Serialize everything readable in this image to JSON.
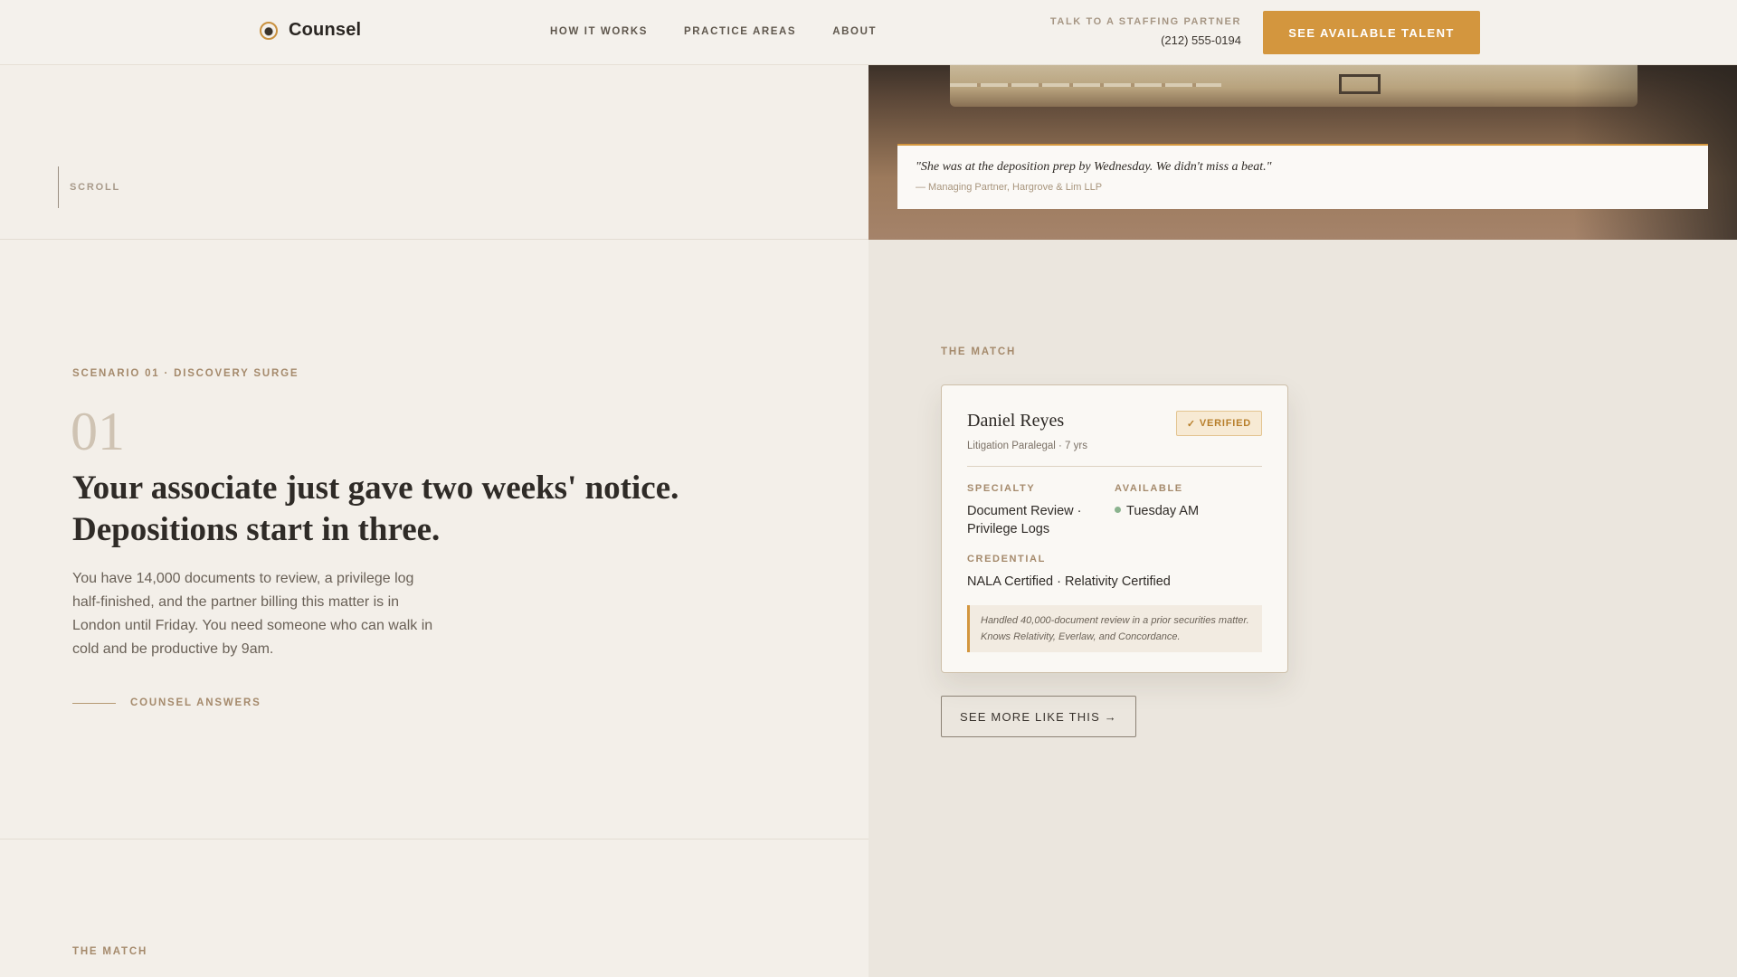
{
  "header": {
    "brand": "Counsel",
    "nav": [
      "HOW IT WORKS",
      "PRACTICE AREAS",
      "ABOUT"
    ],
    "contact_label": "TALK TO A STAFFING PARTNER",
    "contact_phone": "(212) 555-0194",
    "cta_label": "SEE AVAILABLE TALENT"
  },
  "hero": {
    "scroll_label": "SCROLL",
    "quote": "\"She was at the deposition prep by Wednesday. We didn't miss a beat.\"",
    "attribution": "— Managing Partner, Hargrove & Lim LLP"
  },
  "scenario": {
    "eyebrow": "SCENARIO 01 · DISCOVERY SURGE",
    "number": "01",
    "title": "Your associate just gave two weeks' notice. Depositions start in three.",
    "body": "You have 14,000 documents to review, a privilege log half-finished, and the partner billing this matter is in London until Friday. You need someone who can walk in cold and be productive by 9am.",
    "answers_label": "COUNSEL ANSWERS"
  },
  "match": {
    "eyebrow": "THE MATCH",
    "name": "Daniel Reyes",
    "role": "Litigation Paralegal · 7 yrs",
    "verified_label": "VERIFIED",
    "specialty_label": "SPECIALTY",
    "specialty_value": "Document Review · Privilege Logs",
    "available_label": "AVAILABLE",
    "available_value": "Tuesday AM",
    "credential_label": "CREDENTIAL",
    "credential_value": "NALA Certified · Relativity Certified",
    "note": "Handled 40,000-document review in a prior securities matter. Knows Relativity, Everlaw, and Concordance.",
    "more_button": "SEE MORE LIKE THIS →"
  },
  "next_section": {
    "eyebrow": "THE MATCH"
  },
  "colors": {
    "accent": "#d3963e",
    "background": "#f3efe9",
    "panel": "#ebe6de",
    "available_dot": "#8ab38e"
  }
}
